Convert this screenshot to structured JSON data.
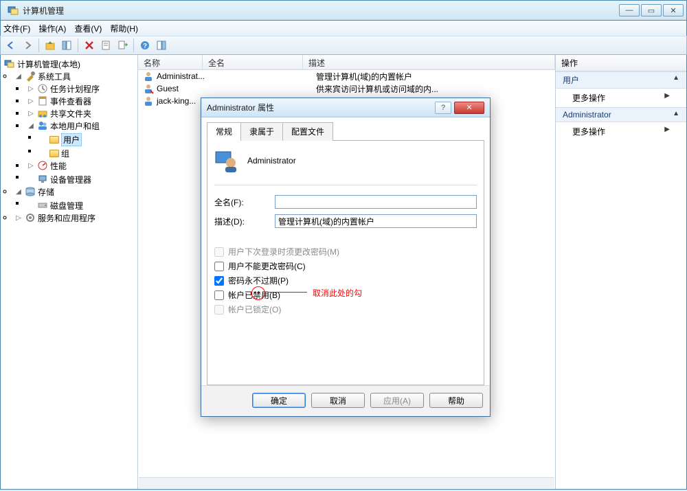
{
  "window": {
    "title": "计算机管理",
    "menus": [
      "文件(F)",
      "操作(A)",
      "查看(V)",
      "帮助(H)"
    ]
  },
  "tree": {
    "root": "计算机管理(本地)",
    "systools": "系统工具",
    "task": "任务计划程序",
    "event": "事件查看器",
    "shared": "共享文件夹",
    "local_users": "本地用户和组",
    "users": "用户",
    "groups": "组",
    "perf": "性能",
    "devmgr": "设备管理器",
    "storage": "存储",
    "disk": "磁盘管理",
    "services": "服务和应用程序"
  },
  "list": {
    "columns": {
      "name": "名称",
      "fullname": "全名",
      "desc": "描述"
    },
    "rows": [
      {
        "name": "Administrat...",
        "fullname": "",
        "desc": "管理计算机(域)的内置帐户"
      },
      {
        "name": "Guest",
        "fullname": "",
        "desc": "供来宾访问计算机或访问域的内..."
      },
      {
        "name": "jack-king...",
        "fullname": "",
        "desc": ""
      }
    ]
  },
  "actions": {
    "title": "操作",
    "group1": "用户",
    "more": "更多操作",
    "group2": "Administrator"
  },
  "dialog": {
    "title": "Administrator 属性",
    "tabs": {
      "general": "常规",
      "memberof": "隶属于",
      "profile": "配置文件"
    },
    "username": "Administrator",
    "fullname_label": "全名(F):",
    "fullname_value": "",
    "desc_label": "描述(D):",
    "desc_value": "管理计算机(域)的内置帐户",
    "chk_must_change": "用户下次登录时须更改密码(M)",
    "chk_cannot_change": "用户不能更改密码(C)",
    "chk_never_expire": "密码永不过期(P)",
    "chk_disabled": "帐户已禁用(B)",
    "chk_locked": "帐户已锁定(O)",
    "annotation": "取消此处的勾",
    "buttons": {
      "ok": "确定",
      "cancel": "取消",
      "apply": "应用(A)",
      "help": "帮助"
    }
  }
}
